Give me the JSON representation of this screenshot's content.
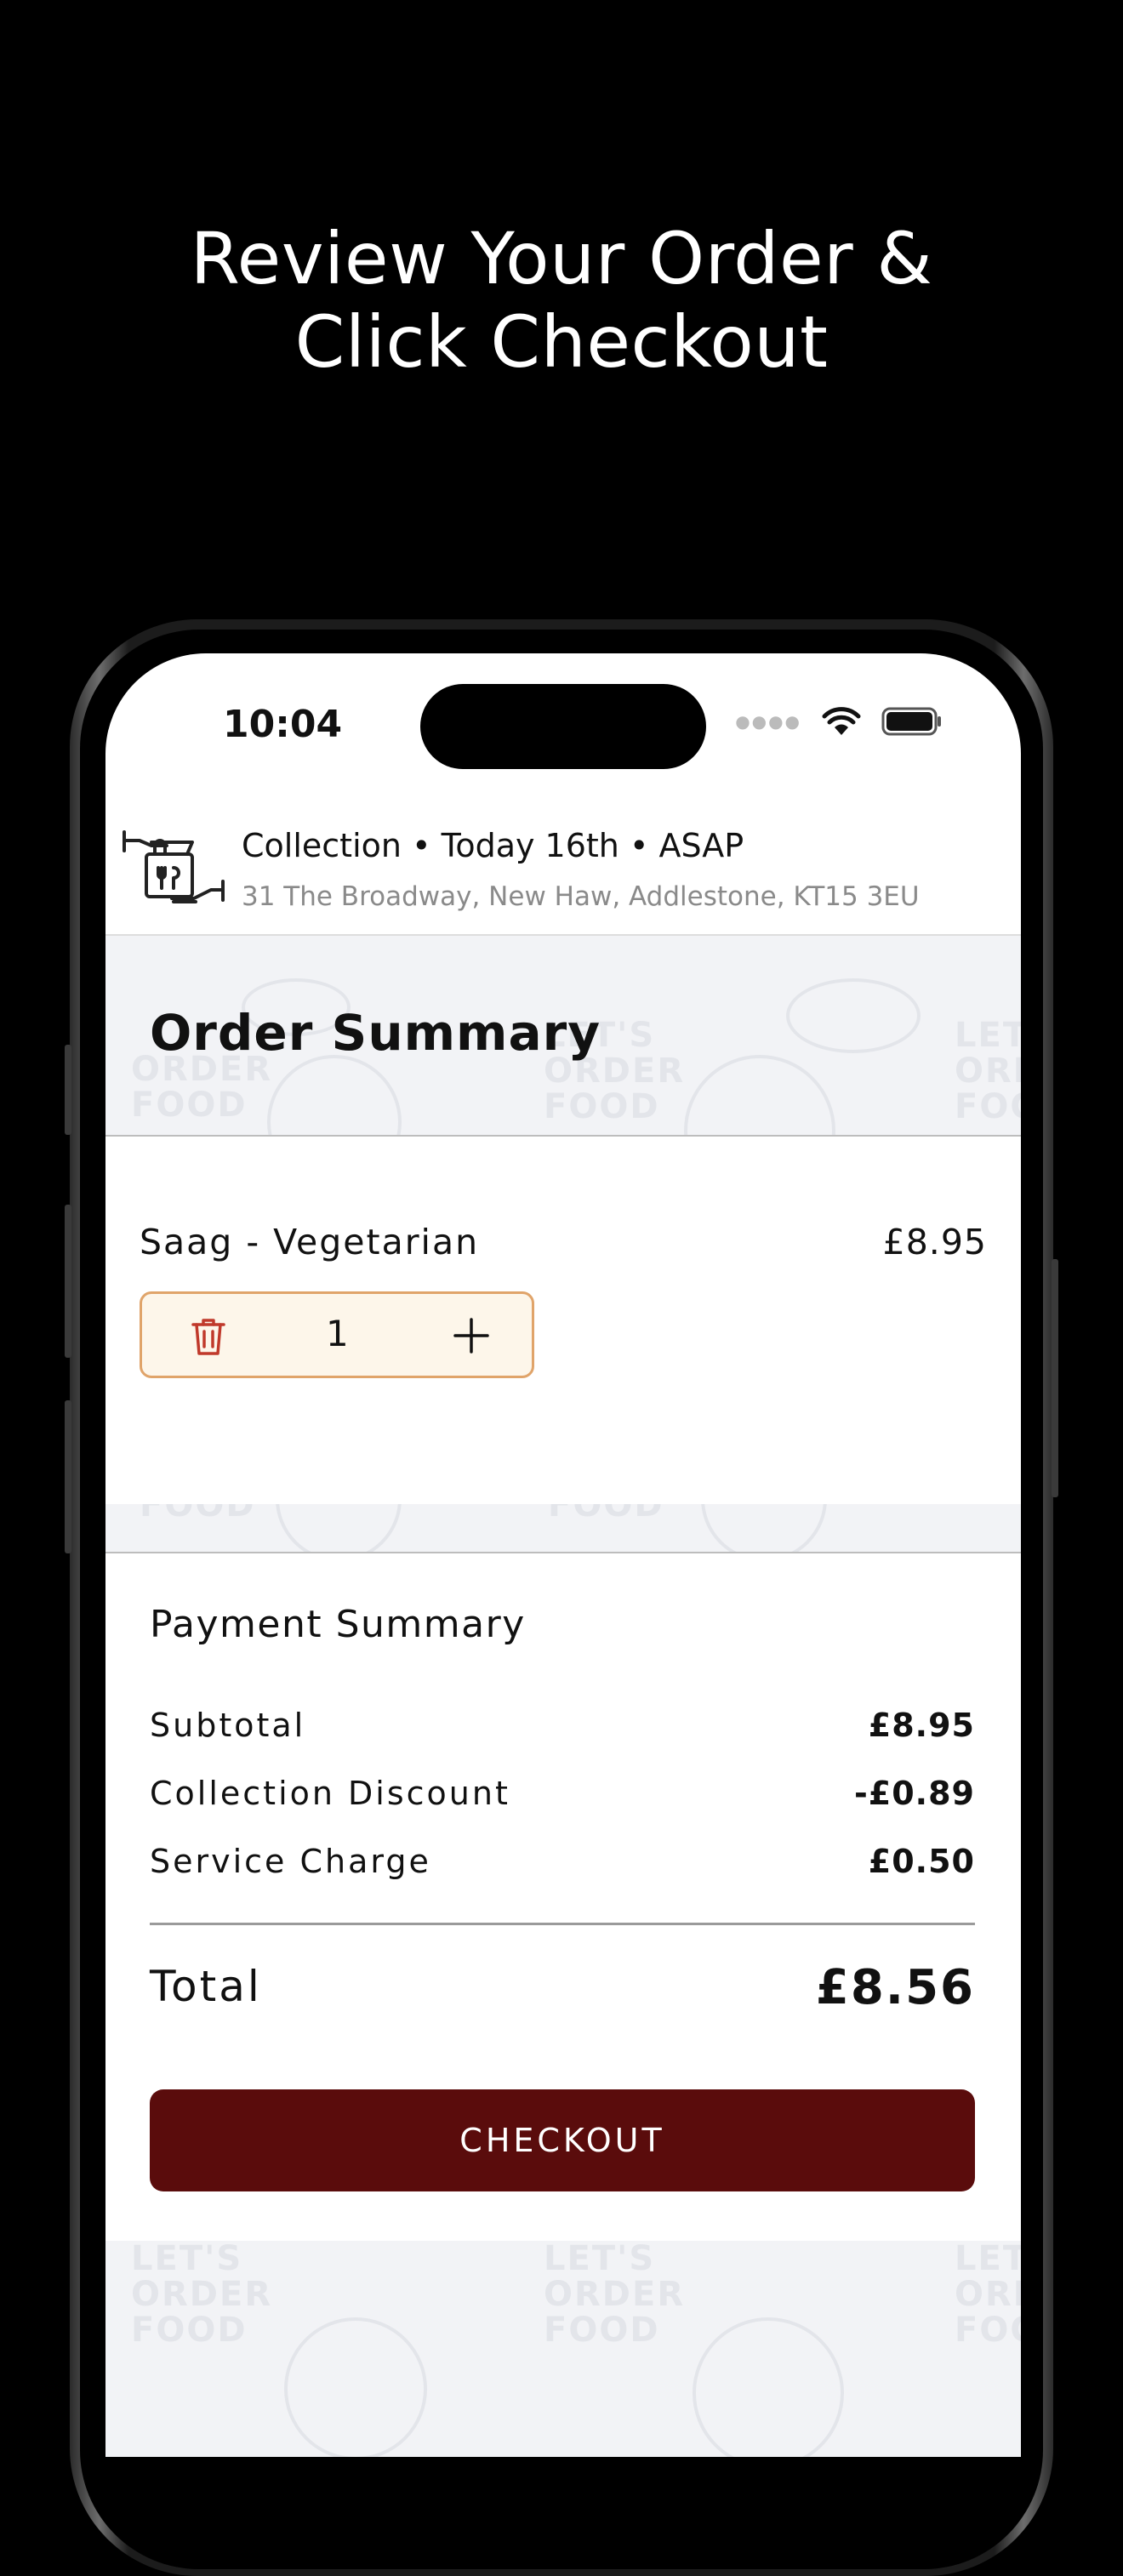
{
  "headline": {
    "line1": "Review Your Order &",
    "line2": "Click Checkout"
  },
  "status_bar": {
    "time": "10:04",
    "icons": [
      "signal-dots-icon",
      "wifi-icon",
      "battery-icon"
    ]
  },
  "collection": {
    "method": "Collection",
    "day": "Today 16th",
    "time": "ASAP",
    "address": "31 The Broadway, New Haw, Addlestone, KT15  3EU",
    "icon": "bag-handover-icon"
  },
  "order_summary": {
    "title": "Order Summary"
  },
  "items": [
    {
      "name": "Saag - Vegetarian",
      "price": "£8.95",
      "quantity": "1"
    }
  ],
  "payment_summary": {
    "title": "Payment Summary",
    "rows": [
      {
        "label": "Subtotal",
        "value": "£8.95"
      },
      {
        "label": "Collection Discount",
        "value": "-£0.89"
      },
      {
        "label": "Service Charge",
        "value": "£0.50"
      }
    ],
    "total_label": "Total",
    "total_value": "£8.56"
  },
  "checkout": {
    "label": "CHECKOUT"
  },
  "watermark": {
    "line1": "LET'S",
    "line2": "ORDER",
    "line3": "FOOD"
  },
  "colors": {
    "checkout_bg": "#5a0c0c",
    "stepper_bg": "#fdf6ea",
    "stepper_border": "#e0a46a",
    "trash": "#c0392b"
  }
}
